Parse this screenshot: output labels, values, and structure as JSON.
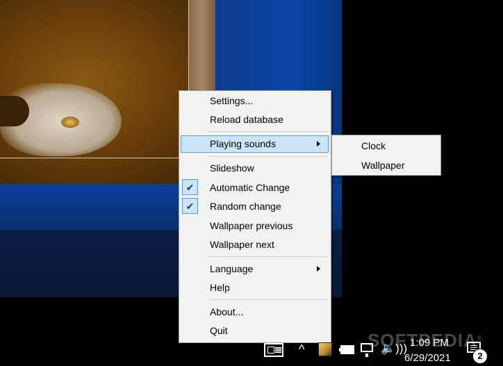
{
  "menu": {
    "items": [
      {
        "label": "Settings...",
        "checked": false,
        "submenu": false
      },
      {
        "label": "Reload database",
        "checked": false,
        "submenu": false
      },
      {
        "label": "Playing sounds",
        "checked": false,
        "submenu": true,
        "highlighted": true
      },
      {
        "label": "Slideshow",
        "checked": false,
        "submenu": false
      },
      {
        "label": "Automatic Change",
        "checked": true,
        "submenu": false
      },
      {
        "label": "Random change",
        "checked": true,
        "submenu": false
      },
      {
        "label": "Wallpaper previous",
        "checked": false,
        "submenu": false
      },
      {
        "label": "Wallpaper next",
        "checked": false,
        "submenu": false
      },
      {
        "label": "Language",
        "checked": false,
        "submenu": true
      },
      {
        "label": "Help",
        "checked": false,
        "submenu": false
      },
      {
        "label": "About...",
        "checked": false,
        "submenu": false
      },
      {
        "label": "Quit",
        "checked": false,
        "submenu": false
      }
    ],
    "check_glyph": "✔"
  },
  "submenu": {
    "items": [
      {
        "label": "Clock"
      },
      {
        "label": "Wallpaper"
      }
    ]
  },
  "taskbar": {
    "time": "1:09 PM",
    "date": "6/29/2021",
    "notification_count": "2",
    "chevron_glyph": "^",
    "volume_glyph": "🔈)))"
  },
  "watermark": {
    "text": "SOFTPEDIA",
    "mark": "®"
  },
  "colors": {
    "menu_bg": "#f2f2f2",
    "highlight_bg": "#cce4f7",
    "highlight_border": "#5b9bd5",
    "desktop_blue": "#0a46a8"
  }
}
